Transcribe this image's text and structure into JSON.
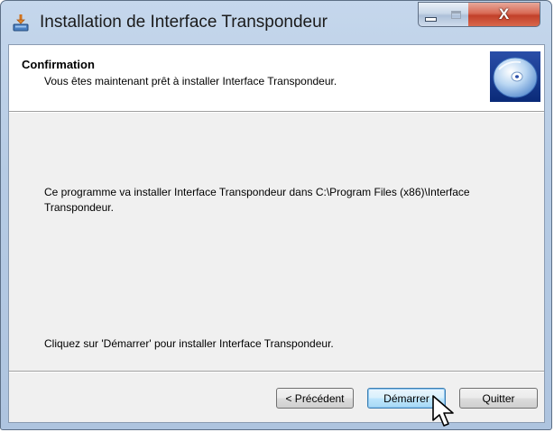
{
  "window": {
    "title": "Installation de Interface Transpondeur",
    "controls": {
      "minimize": "minimize",
      "maximize": "maximize",
      "close": "X"
    }
  },
  "banner": {
    "title": "Confirmation",
    "subtitle": "Vous êtes maintenant prêt à installer Interface Transpondeur.",
    "icon": "cd-disc-icon"
  },
  "body": {
    "install_text": "Ce programme va installer Interface Transpondeur dans C:\\Program Files (x86)\\Interface Transpondeur.",
    "click_text": "Cliquez sur 'Démarrer' pour installer Interface Transpondeur."
  },
  "buttons": {
    "previous": "< Précédent",
    "start": "Démarrer",
    "quit": "Quitter"
  },
  "colors": {
    "titlebar": "#b6cbe4",
    "close_button": "#c2402a",
    "focused_button_border": "#3c7fb1"
  }
}
